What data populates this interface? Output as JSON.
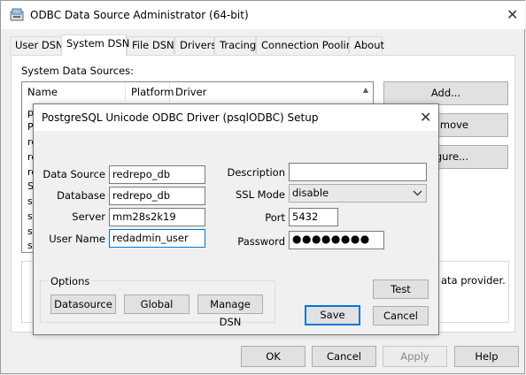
{
  "window": {
    "title": "ODBC Data Source Administrator (64-bit)"
  },
  "tabs": [
    "User DSN",
    "System DSN",
    "File DSN",
    "Drivers",
    "Tracing",
    "Connection Pooling",
    "About"
  ],
  "panel": {
    "list_label": "System Data Sources:",
    "columns": [
      "Name",
      "Platform",
      "Driver"
    ],
    "row_initials": [
      "p",
      "P",
      "re",
      "re",
      "re",
      "S",
      "s",
      "s",
      "s",
      "s"
    ],
    "side_buttons": [
      "Add...",
      "move",
      "figure..."
    ],
    "description_fragment": "ata provider."
  },
  "bottom_buttons": {
    "ok": "OK",
    "cancel": "Cancel",
    "apply": "Apply",
    "help": "Help"
  },
  "dialog": {
    "title": "PostgreSQL Unicode ODBC Driver (psqlODBC) Setup",
    "labels": {
      "data_source": "Data Source",
      "database": "Database",
      "server": "Server",
      "user_name": "User Name",
      "description": "Description",
      "ssl_mode": "SSL Mode",
      "port": "Port",
      "password": "Password"
    },
    "values": {
      "data_source": "redrepo_db",
      "database": "redrepo_db",
      "server": "mm28s2k19",
      "user_name": "redadmin_user",
      "description": "",
      "ssl_mode": "disable",
      "port": "5432",
      "password": "●●●●●●●●"
    },
    "options_label": "Options",
    "buttons": {
      "datasource": "Datasource",
      "global": "Global",
      "manage_dsn": "Manage DSN",
      "test": "Test",
      "save": "Save",
      "cancel": "Cancel"
    }
  }
}
